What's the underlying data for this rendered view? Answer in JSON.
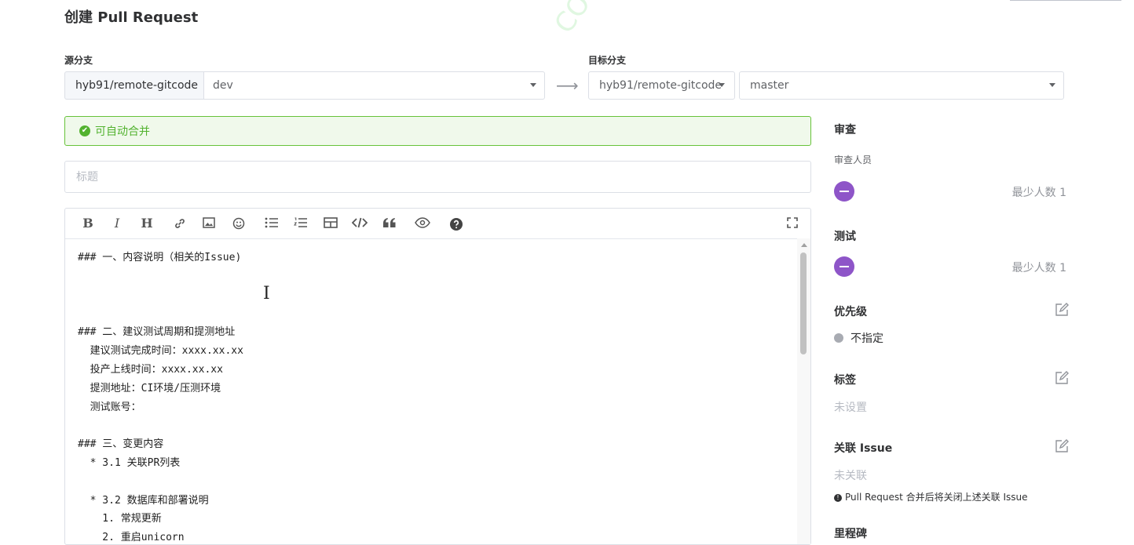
{
  "page": {
    "title": "创建 Pull Request",
    "watermark": "COY"
  },
  "source": {
    "label": "源分支",
    "repo": "hyb91/remote-gitcode",
    "branch": "dev"
  },
  "target": {
    "label": "目标分支",
    "repo": "hyb91/remote-gitcode",
    "branch": "master"
  },
  "merge_status": {
    "text": "可自动合并",
    "icon": "check-circle-icon",
    "color": "#52b22f"
  },
  "title_input": {
    "value": "",
    "placeholder": "标题"
  },
  "toolbar": {
    "items": [
      "bold-icon",
      "italic-icon",
      "heading-icon",
      "link-icon",
      "image-icon",
      "emoji-icon",
      "bullet-list-icon",
      "ordered-list-icon",
      "table-icon",
      "code-icon",
      "quote-icon",
      "preview-icon",
      "help-icon",
      "fullscreen-icon"
    ]
  },
  "editor": {
    "lines": [
      "### 一、内容说明（相关的Issue)",
      "",
      "",
      "",
      "### 二、建议测试周期和提测地址",
      "  建议测试完成时间：xxxx.xx.xx",
      "  投产上线时间：xxxx.xx.xx",
      "  提测地址：CI环境/压测环境",
      "  测试账号：",
      "",
      "### 三、变更内容",
      "  * 3.1 关联PR列表",
      "",
      "  * 3.2 数据库和部署说明",
      "    1. 常规更新",
      "    2. 重启unicorn"
    ]
  },
  "sidebar": {
    "review": {
      "title": "审查",
      "subtitle": "审查人员",
      "min_count": "最少人数 1"
    },
    "test": {
      "title": "测试",
      "min_count": "最少人数 1"
    },
    "priority": {
      "title": "优先级",
      "value": "不指定"
    },
    "labels": {
      "title": "标签",
      "value": "未设置"
    },
    "issue": {
      "title": "关联 Issue",
      "value": "未关联",
      "note": "Pull Request 合并后将关闭上述关联 Issue"
    },
    "next_title": "里程碑"
  }
}
